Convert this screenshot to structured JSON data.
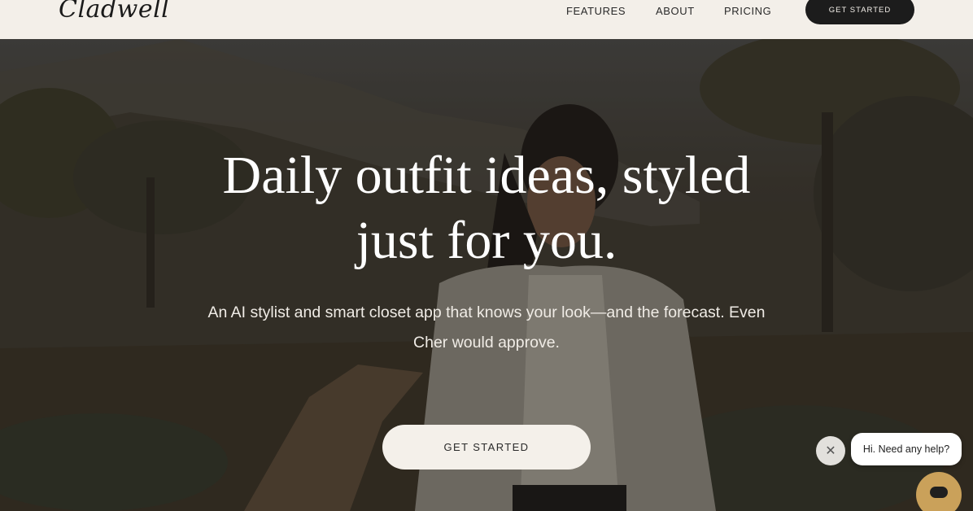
{
  "header": {
    "logo": "Cladwell",
    "nav": [
      "FEATURES",
      "ABOUT",
      "PRICING"
    ],
    "cta_label": "GET STARTED"
  },
  "hero": {
    "headline_line1": "Daily outfit ideas, styled",
    "headline_line2": "just for you.",
    "subtext_line1": "An AI stylist and smart closet app that knows your look—and the forecast. Even",
    "subtext_line2": "Cher would approve.",
    "cta_label": "GET STARTED"
  },
  "chat": {
    "close_glyph": "✕",
    "bubble_text": "Hi. Need any help?"
  },
  "colors": {
    "header_bg": "#f3efe9",
    "dark_button": "#1c1c1c",
    "chat_launcher": "#caa15a"
  }
}
